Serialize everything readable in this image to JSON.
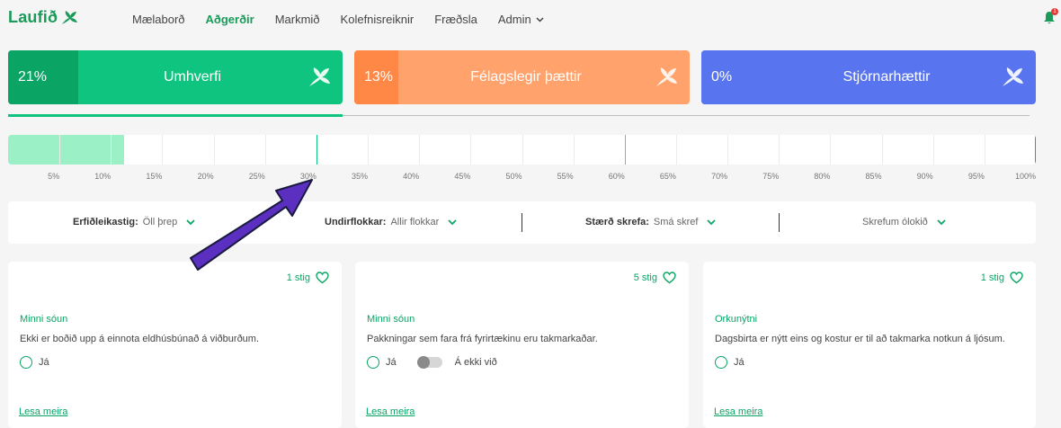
{
  "nav": {
    "logo": "Laufið",
    "links": [
      "Mælaborð",
      "Aðgerðir",
      "Markmið",
      "Kolefnisreiknir",
      "Fræðsla"
    ],
    "admin": "Admin",
    "active_index": 1,
    "notification_count": "1"
  },
  "categories": [
    {
      "percent": "21%",
      "name": "Umhverfi"
    },
    {
      "percent": "13%",
      "name": "Félagslegir þættir"
    },
    {
      "percent": "0%",
      "name": "Stjórnarhættir"
    }
  ],
  "progress": {
    "fill_percent": 11.3,
    "markers": [
      {
        "percent": 30,
        "color": "#0fc47e"
      },
      {
        "percent": 60,
        "color": "#ff8847"
      },
      {
        "percent": 100,
        "color": "#5874ee"
      }
    ],
    "ticks": [
      "5%",
      "10%",
      "15%",
      "20%",
      "25%",
      "30%",
      "35%",
      "40%",
      "45%",
      "50%",
      "55%",
      "60%",
      "65%",
      "70%",
      "75%",
      "80%",
      "85%",
      "90%",
      "95%",
      "100%"
    ]
  },
  "filters": {
    "difficulty_label": "Erfiðleikastig:",
    "difficulty_value": "Öll þrep",
    "subcategory_label": "Undirflokkar:",
    "subcategory_value": "Allir flokkar",
    "step_size_label": "Stærð skrefa:",
    "step_size_value": "Smá skref",
    "sort_value": "Skrefum ólokið"
  },
  "cards": [
    {
      "points": "1 stig",
      "category": "Minni sóun",
      "description": "Ekki er boðið upp á einnota eldhúsbúnað á viðburðum.",
      "yes": "Já",
      "more": "Lesa meira"
    },
    {
      "points": "5 stig",
      "category": "Minni sóun",
      "description": "Pakkningar sem fara frá fyrirtækinu eru takmarkaðar.",
      "yes": "Já",
      "na": "Á ekki við",
      "more": "Lesa meira"
    },
    {
      "points": "1 stig",
      "category": "Orkunýtni",
      "description": "Dagsbirta er nýtt eins og kostur er til að takmarka notkun á ljósum.",
      "yes": "Já",
      "more": "Lesa meira"
    }
  ],
  "colors": {
    "green": "#0fc47e",
    "orange": "#ff8847",
    "blue": "#5874ee",
    "arrow": "#5b2fbf"
  }
}
